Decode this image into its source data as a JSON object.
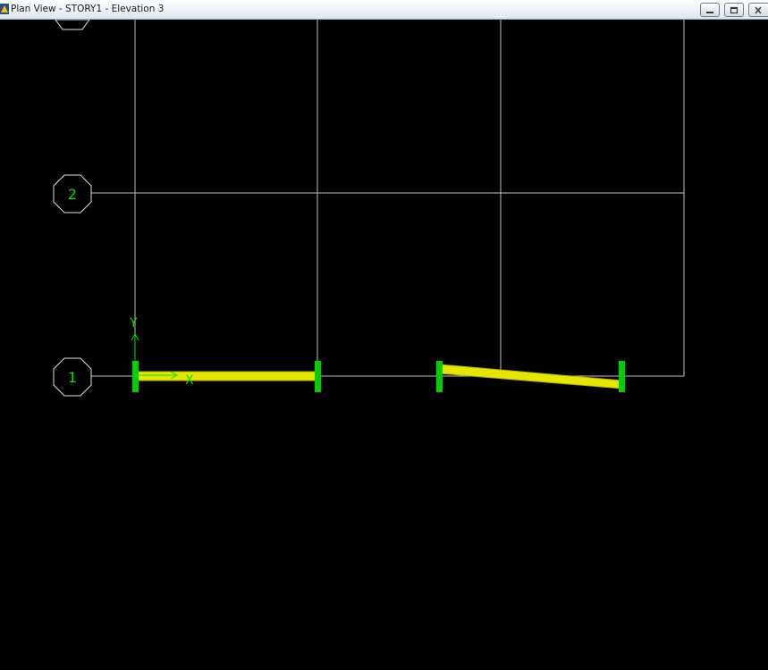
{
  "window": {
    "title": "Plan View - STORY1 - Elevation 3",
    "buttons": {
      "minimize": "minimize",
      "restore": "restore",
      "close": "close"
    }
  },
  "grid": {
    "bubbles": [
      {
        "id": "2",
        "label": "2"
      },
      {
        "id": "1",
        "label": "1"
      }
    ]
  },
  "axes": {
    "y_label": "Y",
    "x_label": "X"
  },
  "colors": {
    "background": "#000000",
    "grid_line": "#bfbfbf",
    "bubble_outline": "#e0e0e0",
    "bubble_text": "#00e000",
    "column": "#00d000",
    "beam": "#e6e600",
    "axis": "#00e000"
  }
}
